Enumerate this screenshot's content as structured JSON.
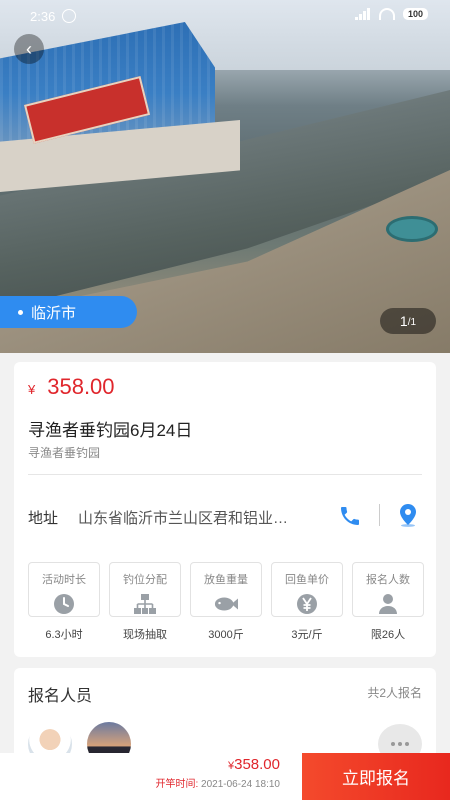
{
  "status_bar": {
    "time": "2:36",
    "battery": "100"
  },
  "hero": {
    "city": "临沂市",
    "image_index": "1",
    "image_total": "/1"
  },
  "event": {
    "price_symbol": "¥",
    "price": "358.00",
    "title": "寻渔者垂钓园6月24日",
    "venue": "寻渔者垂钓园",
    "address_label": "地址",
    "address": "山东省临沂市兰山区君和铝业…"
  },
  "stats": [
    {
      "label": "活动时长",
      "value": "6.3小时",
      "icon": "clock-icon"
    },
    {
      "label": "钓位分配",
      "value": "现场抽取",
      "icon": "hierarchy-icon"
    },
    {
      "label": "放鱼重量",
      "value": "3000斤",
      "icon": "fish-icon"
    },
    {
      "label": "回鱼单价",
      "value": "3元/斤",
      "icon": "yen-icon"
    },
    {
      "label": "报名人数",
      "value": "限26人",
      "icon": "person-icon"
    }
  ],
  "registrants": {
    "title": "报名人员",
    "count": "共2人报名"
  },
  "bottom_bar": {
    "price_symbol": "¥",
    "price": "358.00",
    "start_label": "开竿时间:",
    "start_time": "2021-06-24 18:10",
    "signup_label": "立即报名"
  },
  "colors": {
    "accent": "#2f8cf0",
    "price": "#e0262c",
    "signup": "#f0402a"
  }
}
